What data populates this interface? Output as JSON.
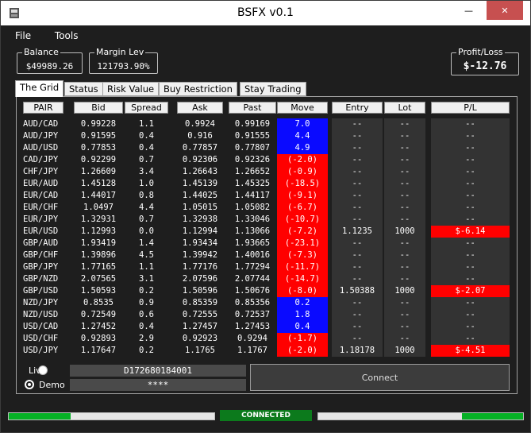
{
  "window": {
    "title": "BSFX v0.1",
    "minimize": "—",
    "maximize": "☐",
    "close": "✕"
  },
  "menu": {
    "file": "File",
    "tools": "Tools"
  },
  "stats": {
    "balance_label": "Balance",
    "balance": "$49989.26",
    "margin_label": "Margin Lev",
    "margin": "121793.90%",
    "pl_label": "Profit/Loss",
    "pl": "$-12.76"
  },
  "tabs": [
    "The Grid",
    "Status",
    "Risk Value",
    "Buy Restriction",
    "Stay Trading"
  ],
  "grid": {
    "headers": [
      "PAIR",
      "Bid",
      "Spread",
      "Ask",
      "Past",
      "Move",
      "Entry",
      "Lot",
      "P/L"
    ],
    "rows": [
      {
        "pair": "AUD/CAD",
        "bid": "0.99228",
        "spread": "1.1",
        "ask": "0.9924",
        "past": "0.99169",
        "move": "7.0",
        "neg": false,
        "entry": "--",
        "lot": "--",
        "pl": "--",
        "plneg": false
      },
      {
        "pair": "AUD/JPY",
        "bid": "0.91595",
        "spread": "0.4",
        "ask": "0.916",
        "past": "0.91555",
        "move": "4.4",
        "neg": false,
        "entry": "--",
        "lot": "--",
        "pl": "--",
        "plneg": false
      },
      {
        "pair": "AUD/USD",
        "bid": "0.77853",
        "spread": "0.4",
        "ask": "0.77857",
        "past": "0.77807",
        "move": "4.9",
        "neg": false,
        "entry": "--",
        "lot": "--",
        "pl": "--",
        "plneg": false
      },
      {
        "pair": "CAD/JPY",
        "bid": "0.92299",
        "spread": "0.7",
        "ask": "0.92306",
        "past": "0.92326",
        "move": "(-2.0)",
        "neg": true,
        "entry": "--",
        "lot": "--",
        "pl": "--",
        "plneg": false
      },
      {
        "pair": "CHF/JPY",
        "bid": "1.26609",
        "spread": "3.4",
        "ask": "1.26643",
        "past": "1.26652",
        "move": "(-0.9)",
        "neg": true,
        "entry": "--",
        "lot": "--",
        "pl": "--",
        "plneg": false
      },
      {
        "pair": "EUR/AUD",
        "bid": "1.45128",
        "spread": "1.0",
        "ask": "1.45139",
        "past": "1.45325",
        "move": "(-18.5)",
        "neg": true,
        "entry": "--",
        "lot": "--",
        "pl": "--",
        "plneg": false
      },
      {
        "pair": "EUR/CAD",
        "bid": "1.44017",
        "spread": "0.8",
        "ask": "1.44025",
        "past": "1.44117",
        "move": "(-9.1)",
        "neg": true,
        "entry": "--",
        "lot": "--",
        "pl": "--",
        "plneg": false
      },
      {
        "pair": "EUR/CHF",
        "bid": "1.0497",
        "spread": "4.4",
        "ask": "1.05015",
        "past": "1.05082",
        "move": "(-6.7)",
        "neg": true,
        "entry": "--",
        "lot": "--",
        "pl": "--",
        "plneg": false
      },
      {
        "pair": "EUR/JPY",
        "bid": "1.32931",
        "spread": "0.7",
        "ask": "1.32938",
        "past": "1.33046",
        "move": "(-10.7)",
        "neg": true,
        "entry": "--",
        "lot": "--",
        "pl": "--",
        "plneg": false
      },
      {
        "pair": "EUR/USD",
        "bid": "1.12993",
        "spread": "0.0",
        "ask": "1.12994",
        "past": "1.13066",
        "move": "(-7.2)",
        "neg": true,
        "entry": "1.1235",
        "lot": "1000",
        "pl": "$-6.14",
        "plneg": true
      },
      {
        "pair": "GBP/AUD",
        "bid": "1.93419",
        "spread": "1.4",
        "ask": "1.93434",
        "past": "1.93665",
        "move": "(-23.1)",
        "neg": true,
        "entry": "--",
        "lot": "--",
        "pl": "--",
        "plneg": false
      },
      {
        "pair": "GBP/CHF",
        "bid": "1.39896",
        "spread": "4.5",
        "ask": "1.39942",
        "past": "1.40016",
        "move": "(-7.3)",
        "neg": true,
        "entry": "--",
        "lot": "--",
        "pl": "--",
        "plneg": false
      },
      {
        "pair": "GBP/JPY",
        "bid": "1.77165",
        "spread": "1.1",
        "ask": "1.77176",
        "past": "1.77294",
        "move": "(-11.7)",
        "neg": true,
        "entry": "--",
        "lot": "--",
        "pl": "--",
        "plneg": false
      },
      {
        "pair": "GBP/NZD",
        "bid": "2.07565",
        "spread": "3.1",
        "ask": "2.07596",
        "past": "2.07744",
        "move": "(-14.7)",
        "neg": true,
        "entry": "--",
        "lot": "--",
        "pl": "--",
        "plneg": false
      },
      {
        "pair": "GBP/USD",
        "bid": "1.50593",
        "spread": "0.2",
        "ask": "1.50596",
        "past": "1.50676",
        "move": "(-8.0)",
        "neg": true,
        "entry": "1.50388",
        "lot": "1000",
        "pl": "$-2.07",
        "plneg": true
      },
      {
        "pair": "NZD/JPY",
        "bid": "0.8535",
        "spread": "0.9",
        "ask": "0.85359",
        "past": "0.85356",
        "move": "0.2",
        "neg": false,
        "entry": "--",
        "lot": "--",
        "pl": "--",
        "plneg": false
      },
      {
        "pair": "NZD/USD",
        "bid": "0.72549",
        "spread": "0.6",
        "ask": "0.72555",
        "past": "0.72537",
        "move": "1.8",
        "neg": false,
        "entry": "--",
        "lot": "--",
        "pl": "--",
        "plneg": false
      },
      {
        "pair": "USD/CAD",
        "bid": "1.27452",
        "spread": "0.4",
        "ask": "1.27457",
        "past": "1.27453",
        "move": "0.4",
        "neg": false,
        "entry": "--",
        "lot": "--",
        "pl": "--",
        "plneg": false
      },
      {
        "pair": "USD/CHF",
        "bid": "0.92893",
        "spread": "2.9",
        "ask": "0.92923",
        "past": "0.9294",
        "move": "(-1.7)",
        "neg": true,
        "entry": "--",
        "lot": "--",
        "pl": "--",
        "plneg": false
      },
      {
        "pair": "USD/JPY",
        "bid": "1.17647",
        "spread": "0.2",
        "ask": "1.1765",
        "past": "1.1767",
        "move": "(-2.0)",
        "neg": true,
        "entry": "1.18178",
        "lot": "1000",
        "pl": "$-4.51",
        "plneg": true
      }
    ]
  },
  "login": {
    "live_label": "Live",
    "demo_label": "Demo",
    "account": "D172680184001",
    "password": "****",
    "connect": "Connect",
    "selected": "Demo"
  },
  "status": {
    "text": "CONNECTED",
    "left_progress": 0.3,
    "right_progress": 0.3
  },
  "colors": {
    "positive_move": "#0a0aff",
    "negative": "#ff0000",
    "connected": "#0c7a1c",
    "progress": "#06b025"
  }
}
